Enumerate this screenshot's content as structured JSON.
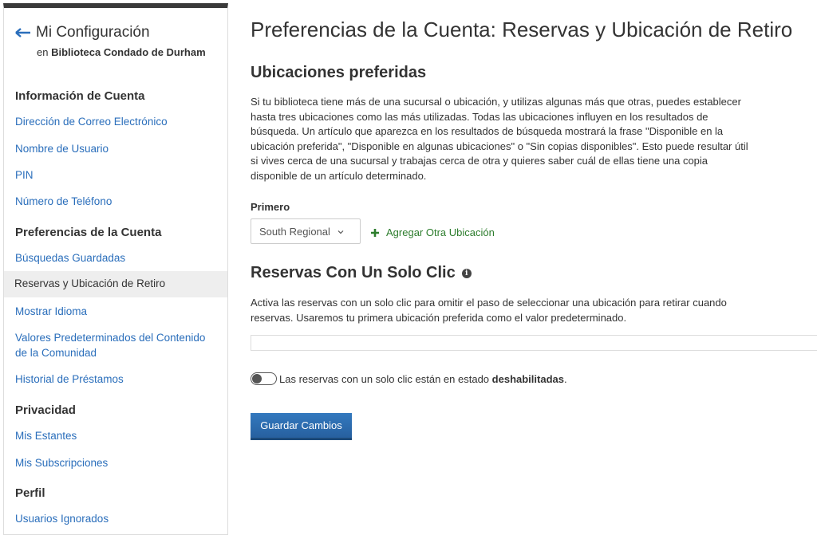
{
  "sidebar": {
    "title": "Mi Configuración",
    "subtitle_prefix": "en",
    "library": "Biblioteca Condado de Durham",
    "sections": {
      "account_info": "Información de Cuenta",
      "account_prefs": "Preferencias de la Cuenta",
      "privacy": "Privacidad",
      "profile": "Perfil"
    },
    "items": {
      "email": "Dirección de Correo Electrónico",
      "username": "Nombre de Usuario",
      "pin": "PIN",
      "phone": "Número de Teléfono",
      "saved_searches": "Búsquedas Guardadas",
      "holds_pickup": "Reservas y Ubicación de Retiro",
      "display_language": "Mostrar Idioma",
      "community_defaults_1": "Valores Predeterminados del Contenido",
      "community_defaults_2": "de la Comunidad",
      "checkout_history": "Historial de Préstamos",
      "my_shelves": "Mis Estantes",
      "my_subscriptions": "Mis Subscripciones",
      "ignored_users": "Usuarios Ignorados"
    }
  },
  "main": {
    "page_title": "Preferencias de la Cuenta: Reservas y Ubicación de Retiro",
    "preferred": {
      "heading": "Ubicaciones preferidas",
      "description": "Si tu biblioteca tiene más de una sucursal o ubicación, y utilizas algunas más que otras, puedes establecer hasta tres ubicaciones como las más utilizadas. Todas las ubicaciones influyen en los resultados de búsqueda. Un artículo que aparezca en los resultados de búsqueda mostrará la frase \"Disponible en la ubicación preferida\", \"Disponible en algunas ubicaciones\" o \"Sin copias disponibles\". Esto puede resultar útil si vives cerca de una sucursal y trabajas cerca de otra y quieres saber cuál de ellas tiene una copia disponible de un artículo determinado.",
      "first_label": "Primero",
      "first_value": "South Regional",
      "add_location": "Agregar Otra Ubicación"
    },
    "one_click": {
      "heading": "Reservas Con Un Solo Clic",
      "description": "Activa las reservas con un solo clic para omitir el paso de seleccionar una ubicación para retirar cuando reservas. Usaremos tu primera ubicación preferida como el valor predeterminado.",
      "status_prefix": "Las reservas con un solo clic están en estado",
      "status_value": "deshabilitadas",
      "status_suffix": "."
    },
    "save_label": "Guardar Cambios"
  },
  "colors": {
    "link": "#2a6ebb",
    "add": "#2d7d2d",
    "button": "#2a6ebb"
  }
}
